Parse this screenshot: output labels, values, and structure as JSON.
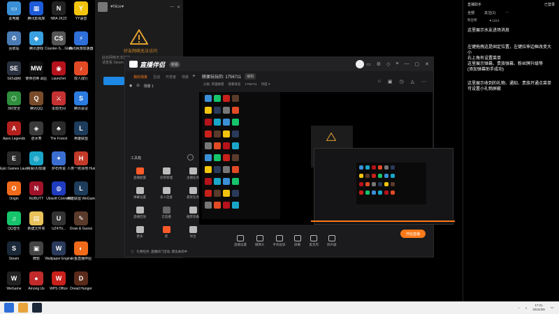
{
  "desktop_icons": [
    {
      "label": "此电脑",
      "color": "#3b8fd6",
      "glyph": "▭",
      "icon": "computer-icon"
    },
    {
      "label": "腾讯影视库",
      "color": "#1e5bd8",
      "glyph": "▦",
      "icon": "tile-icon"
    },
    {
      "label": "NBA 2K22",
      "color": "#222",
      "glyph": "N",
      "icon": "nba-icon"
    },
    {
      "label": "YY语音",
      "color": "#f2c40e",
      "glyph": "Y",
      "icon": "yy-icon"
    },
    {
      "label": "回收站",
      "color": "#4a7bb5",
      "glyph": "♻",
      "icon": "recycle-icon"
    },
    {
      "label": "腾讯游戏",
      "color": "#3aa1e0",
      "glyph": "◆",
      "icon": "game-icon"
    },
    {
      "label": "Counter-S... Global Off...",
      "color": "#555",
      "glyph": "CS",
      "icon": "cs-icon"
    },
    {
      "label": "腾讯网游加速器",
      "color": "#2e6fd8",
      "glyph": "⚡",
      "icon": "accelerator-icon"
    },
    {
      "label": "SE5战网",
      "color": "#2a3140",
      "glyph": "SE",
      "icon": "se-icon"
    },
    {
      "label": "使命召唤 战区",
      "color": "#111",
      "glyph": "MW",
      "icon": "mw-icon"
    },
    {
      "label": "Launcher",
      "color": "#b5121b",
      "glyph": "◉",
      "icon": "launcher-icon"
    },
    {
      "label": "双人成行",
      "color": "#e24a25",
      "glyph": "♪",
      "icon": "ittakestwo-icon"
    },
    {
      "label": "360安全",
      "color": "#2e8f3d",
      "glyph": "⬡",
      "icon": "360-icon"
    },
    {
      "label": "腾讯QQ",
      "color": "#7a4b2a",
      "glyph": "Q",
      "icon": "qq-icon"
    },
    {
      "label": "永劫无间",
      "color": "#c43232",
      "glyph": "⚔",
      "icon": "naraka-icon"
    },
    {
      "label": "腾讯会议",
      "color": "#2b7be0",
      "glyph": "S",
      "icon": "meeting-icon"
    },
    {
      "label": "Apex Legends",
      "color": "#b3211e",
      "glyph": "A",
      "icon": "apex-icon"
    },
    {
      "label": "逆水寒",
      "color": "#3a3a3a",
      "glyph": "◈",
      "icon": "nsh-icon"
    },
    {
      "label": "The Forest",
      "color": "#2b2b2b",
      "glyph": "♣",
      "icon": "forest-icon"
    },
    {
      "label": "英雄联盟",
      "color": "#1d3b5a",
      "glyph": "L",
      "icon": "lol-icon"
    },
    {
      "label": "Epic Games Launcher",
      "color": "#2a2a2a",
      "glyph": "E",
      "icon": "epic-icon"
    },
    {
      "label": "网易UU加速",
      "color": "#1aa6c9",
      "glyph": "◎",
      "icon": "uu-icon"
    },
    {
      "label": "炉石传说",
      "color": "#3a6fd0",
      "glyph": "✦",
      "icon": "hearthstone-icon"
    },
    {
      "label": "人类一败涂地 Human F...",
      "color": "#c23a2a",
      "glyph": "H",
      "icon": "human-icon"
    },
    {
      "label": "Origin",
      "color": "#f06a1a",
      "glyph": "O",
      "icon": "origin-icon"
    },
    {
      "label": "NUBUTT",
      "color": "#a0122a",
      "glyph": "N",
      "icon": "nubutt-icon"
    },
    {
      "label": "Ubisoft Connect",
      "color": "#1f3cbf",
      "glyph": "◍",
      "icon": "ubisoft-icon"
    },
    {
      "label": "英雄联盟 WeGame版",
      "color": "#1d3b5a",
      "glyph": "L",
      "icon": "lolwg-icon"
    },
    {
      "label": "QQ音乐",
      "color": "#16c46b",
      "glyph": "♫",
      "icon": "qqmusic-icon"
    },
    {
      "label": "新建文件夹",
      "color": "#e8c25a",
      "glyph": "▤",
      "icon": "folder-icon"
    },
    {
      "label": "UZ47N...",
      "color": "#333",
      "glyph": "U",
      "icon": "uz-icon"
    },
    {
      "label": "Draw & Guess",
      "color": "#5a3a2a",
      "glyph": "✎",
      "icon": "drawguess-icon"
    },
    {
      "label": "Steam",
      "color": "#1b2838",
      "glyph": "S",
      "icon": "steam-icon"
    },
    {
      "label": "微软",
      "color": "#444",
      "glyph": "▣",
      "icon": "ms-icon"
    },
    {
      "label": "Wallpaper Engine",
      "color": "#2a3a5a",
      "glyph": "W",
      "icon": "wallpaper-icon"
    },
    {
      "label": "斗鱼直播伴侣",
      "color": "#f06a1a",
      "glyph": "◐",
      "icon": "douyu-icon"
    },
    {
      "label": "WeGame",
      "color": "#222",
      "glyph": "W",
      "icon": "wegame-icon"
    },
    {
      "label": "Among Us",
      "color": "#c12b2b",
      "glyph": "●",
      "icon": "amongus-icon"
    },
    {
      "label": "WPS Office",
      "color": "#c8201a",
      "glyph": "W",
      "icon": "wps-icon"
    },
    {
      "label": "Dread Hunger",
      "color": "#5a2a1a",
      "glyph": "D",
      "icon": "dread-icon"
    }
  ],
  "chat_window": {
    "name": "♥Nice♥",
    "warning": "好友网络无法访问",
    "line1": "此处网络无法连接",
    "line2": "请查看 Steam 支持"
  },
  "app": {
    "logo": "直播伴侣",
    "version": "新版",
    "tabs": [
      "我的场景",
      "互动",
      "开发者",
      "场景"
    ],
    "scene_name": "场景 1",
    "room_title": "随便玩玩的: 1756711",
    "room_tag": "编辑",
    "sub_info": [
      "分类: 英雄联盟",
      "观看排名",
      "1756711",
      "热度 0"
    ],
    "tools_title": "工具箱",
    "tools": [
      {
        "label": "直播配置",
        "color": "#ff5a2a"
      },
      {
        "label": "房管管理",
        "color": "#bbb"
      },
      {
        "label": "主播任务",
        "color": "#bbb"
      },
      {
        "label": "弹幕设置",
        "color": "#bbb"
      },
      {
        "label": "多人连麦",
        "color": "#bbb"
      },
      {
        "label": "悬赏任务",
        "color": "#bbb"
      },
      {
        "label": "直播回放",
        "color": "#bbb"
      },
      {
        "label": "云直播",
        "color": "#666"
      },
      {
        "label": "推荐装备",
        "color": "#bbb"
      },
      {
        "label": "更多",
        "color": "#bbb"
      },
      {
        "label": "新",
        "color": "#ff5a2a"
      },
      {
        "label": "导出",
        "color": "#bbb"
      }
    ],
    "notice": "礼物任务, 直播间门活动, 建议关闭中",
    "bottom_tools": [
      "直播设置",
      "摄像头",
      "手机投屏",
      "屏幕",
      "麦克风",
      "扬声器"
    ],
    "go_live": "开始直播"
  },
  "notes": {
    "top_left": "直播助手",
    "top_right": "已登录",
    "bar2": [
      "全部",
      "关注(1)",
      "···"
    ],
    "bar3_left": "粉丝榜",
    "bar3_right": "♥ 1313",
    "paragraphs": [
      "这里展示水友进场消息",
      "左键拖拽这是固定位置，左键拉伸边框改变大小\n右上角有设置菜单\n这里展示弹幕、贵族弹幕、粉丝牌升级等\n(添加弹幕助手成功)",
      "这里展示收到的礼物、通知、贵族开通点菜单可设置小礼物屏蔽"
    ]
  },
  "taskbar": {
    "time": "17:21",
    "date": "2022/3/8"
  }
}
